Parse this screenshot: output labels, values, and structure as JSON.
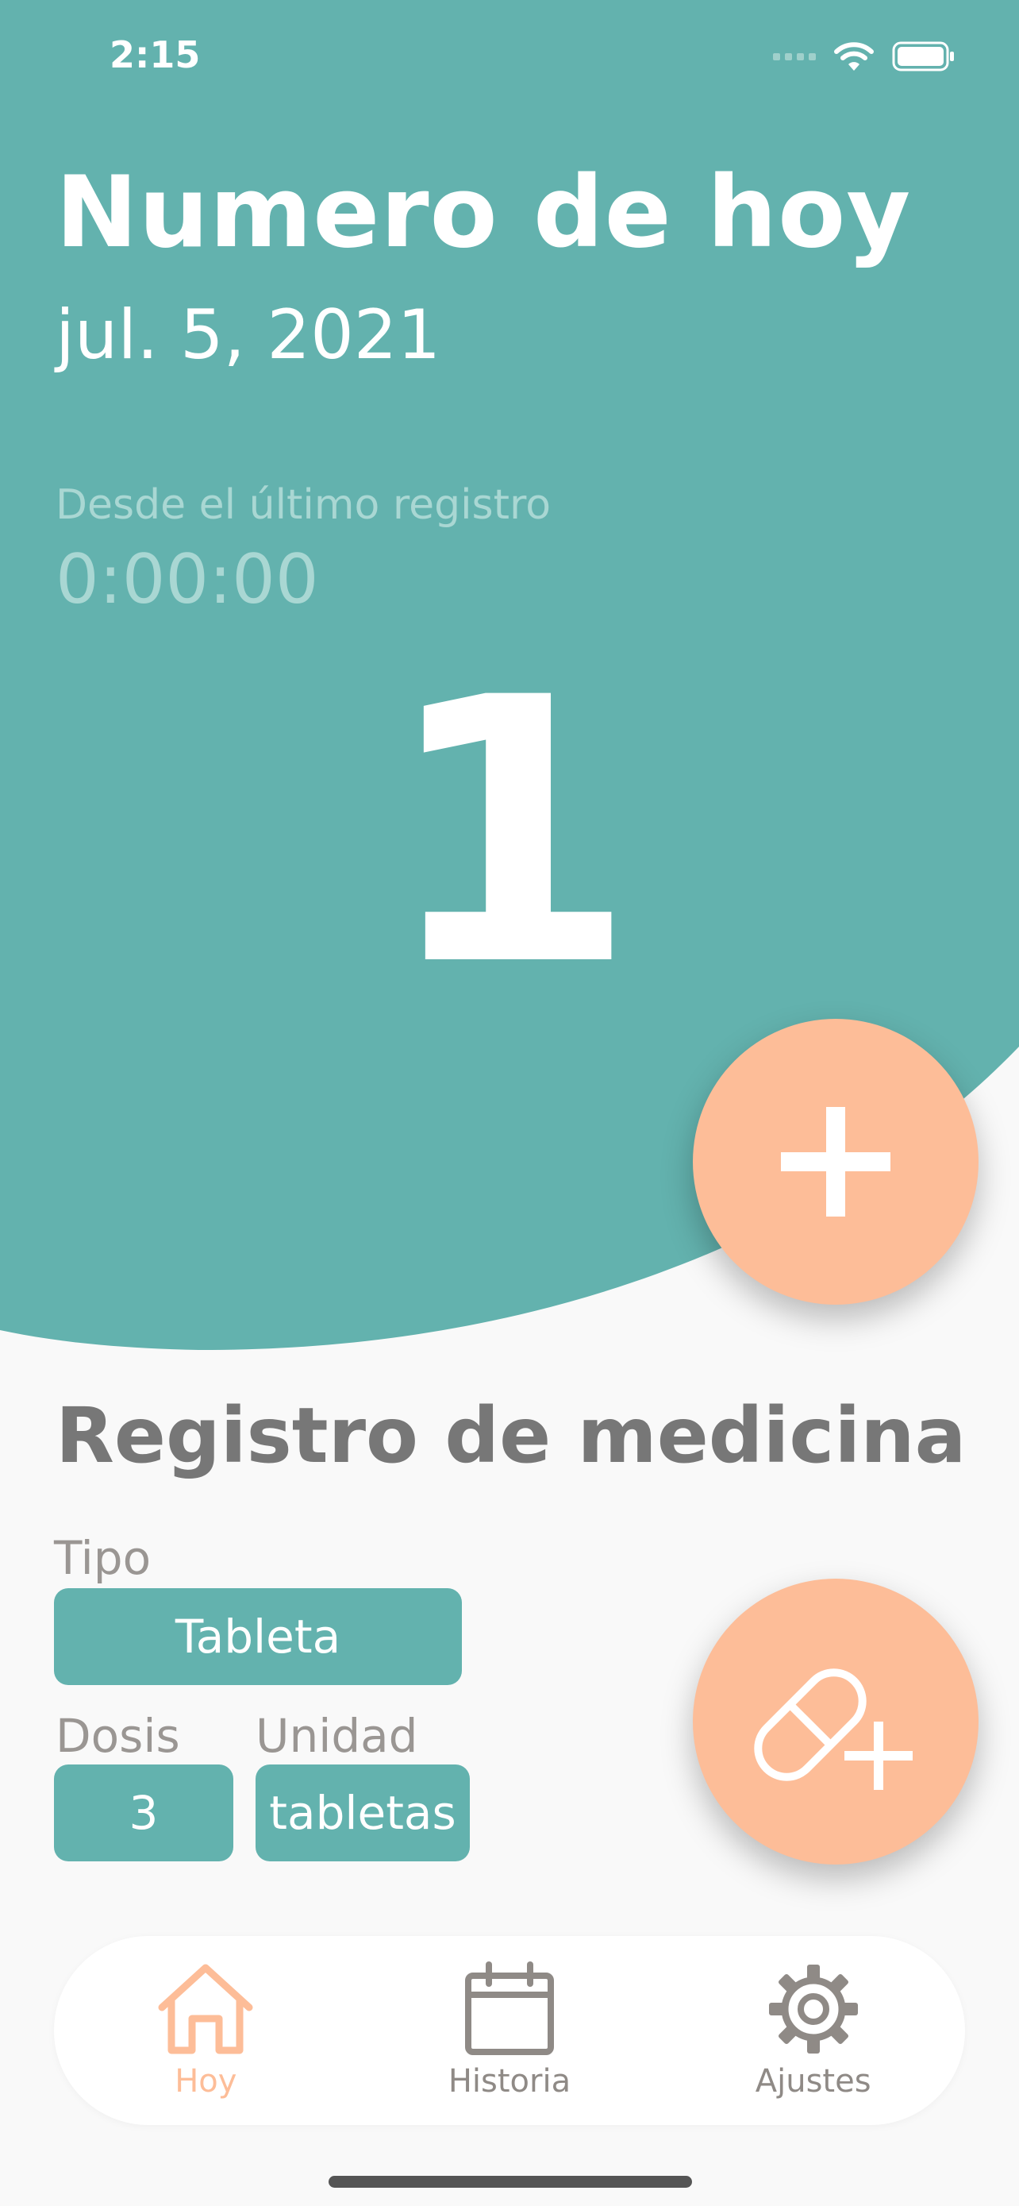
{
  "status_bar": {
    "time": "2:15"
  },
  "header": {
    "title": "Numero de hoy",
    "date": "jul. 5, 2021",
    "since_label": "Desde el último registro",
    "since_value": "0:00:00",
    "count": "1"
  },
  "medicine": {
    "title": "Registro de medicina",
    "tipo_label": "Tipo",
    "tipo_value": "Tableta",
    "dosis_label": "Dosis",
    "dosis_value": "3",
    "unidad_label": "Unidad",
    "unidad_value": "tabletas"
  },
  "tabs": [
    {
      "label": "Hoy",
      "icon": "home-icon",
      "active": true
    },
    {
      "label": "Historia",
      "icon": "calendar-icon",
      "active": false
    },
    {
      "label": "Ajustes",
      "icon": "gear-icon",
      "active": false
    }
  ],
  "colors": {
    "primary": "#63b2ae",
    "accent": "#fdbd98",
    "background": "#f9f9f9",
    "muted_text": "#a9d7d3",
    "inactive_tab": "#8f8a86"
  }
}
